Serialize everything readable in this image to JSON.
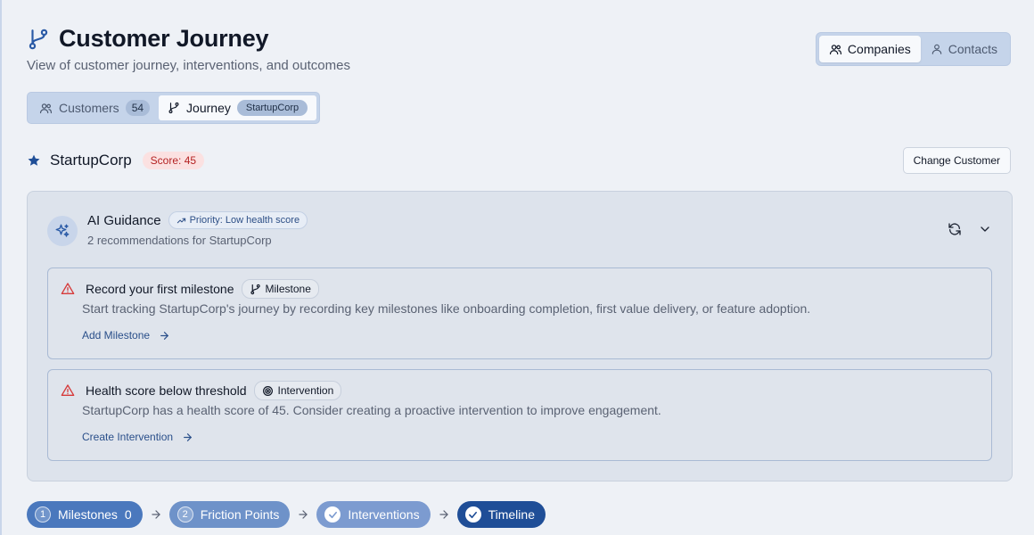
{
  "header": {
    "title": "Customer Journey",
    "subtitle": "View of customer journey, interventions, and outcomes",
    "title_icon": "git-branch-icon"
  },
  "view_switch": {
    "items": [
      {
        "label": "Companies",
        "icon": "users-icon",
        "active": true
      },
      {
        "label": "Contacts",
        "icon": "user-icon",
        "active": false
      }
    ]
  },
  "tabs": {
    "customers": {
      "label": "Customers",
      "count": "54",
      "icon": "users-icon"
    },
    "journey": {
      "label": "Journey",
      "badge": "StartupCorp",
      "icon": "git-branch-icon",
      "active": true
    }
  },
  "customer": {
    "name": "StartupCorp",
    "score_label": "Score: 45",
    "change_button": "Change Customer"
  },
  "ai_guidance": {
    "title": "AI Guidance",
    "priority": "Priority: Low health score",
    "subtitle": "2 recommendations for StartupCorp",
    "recommendations": [
      {
        "title": "Record your first milestone",
        "tag": "Milestone",
        "tag_icon": "git-branch-icon",
        "description": "Start tracking StartupCorp's journey by recording key milestones like onboarding completion, first value delivery, or feature adoption.",
        "action": "Add Milestone"
      },
      {
        "title": "Health score below threshold",
        "tag": "Intervention",
        "tag_icon": "target-icon",
        "description": "StartupCorp has a health score of 45. Consider creating a proactive intervention to improve engagement.",
        "action": "Create Intervention"
      }
    ]
  },
  "steps": [
    {
      "marker": "1",
      "label": "Milestones",
      "count": "0"
    },
    {
      "marker": "2",
      "label": "Friction Points"
    },
    {
      "marker": "check",
      "label": "Interventions"
    },
    {
      "marker": "check",
      "label": "Timeline"
    }
  ],
  "colors": {
    "accent": "#1f4e97",
    "score_badge_bg": "#fbe1e1",
    "score_badge_text": "#b42323",
    "warning_icon": "#d63a3a"
  }
}
